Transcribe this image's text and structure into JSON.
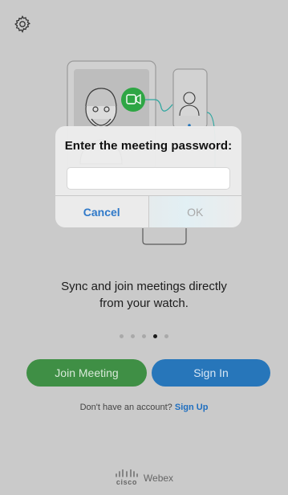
{
  "settings": {
    "icon": "gear-icon"
  },
  "dialog": {
    "title": "Enter the meeting password:",
    "password_value": "",
    "cancel_label": "Cancel",
    "ok_label": "OK"
  },
  "onboarding": {
    "tagline_line1": "Sync and join meetings directly",
    "tagline_line2": "from your watch.",
    "pages_total": 5,
    "page_current": 4
  },
  "actions": {
    "join_label": "Join Meeting",
    "signin_label": "Sign In"
  },
  "signup": {
    "prompt": "Don't have an account?",
    "link": "Sign Up"
  },
  "footer": {
    "brand": "cisco",
    "product": "Webex"
  },
  "colors": {
    "background": "#cacaca",
    "join_green": "#3f8f45",
    "signin_blue": "#2776ba",
    "link_blue": "#1f6fc0",
    "video_badge_green": "#2ea644",
    "connector_teal": "#2fa7a0"
  }
}
